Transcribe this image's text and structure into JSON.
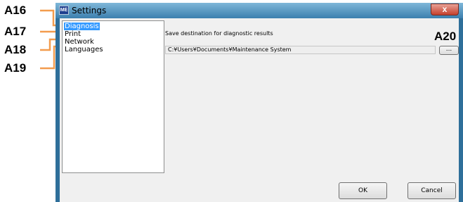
{
  "callouts": {
    "a16": "A16",
    "a17": "A17",
    "a18": "A18",
    "a19": "A19",
    "a20": "A20"
  },
  "window": {
    "title": "Settings",
    "icon_text": "ME",
    "close_label": "x"
  },
  "categories": {
    "items": [
      {
        "label": "Diagnosis",
        "selected": true
      },
      {
        "label": "Print"
      },
      {
        "label": "Network"
      },
      {
        "label": "Languages"
      }
    ]
  },
  "diagnosis": {
    "save_destination_label": "Save destination for diagnostic results",
    "path_value": "C:¥Users¥Documents¥Maintenance System",
    "browse_label": "..."
  },
  "buttons": {
    "ok": "OK",
    "cancel": "Cancel"
  },
  "colors": {
    "callout_line": "#f39c4e",
    "selection": "#3399ff",
    "window_frame": "#2f6f9a"
  }
}
